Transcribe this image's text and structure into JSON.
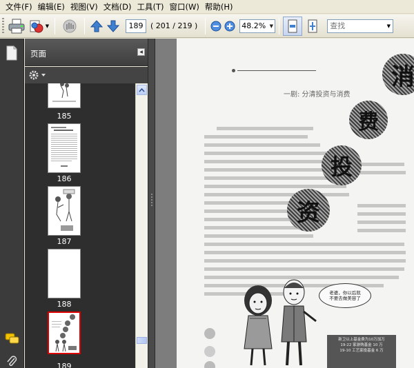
{
  "menu": [
    {
      "label": "文件(F)",
      "name": "menu-file"
    },
    {
      "label": "编辑(E)",
      "name": "menu-edit"
    },
    {
      "label": "视图(V)",
      "name": "menu-view"
    },
    {
      "label": "文档(D)",
      "name": "menu-document"
    },
    {
      "label": "工具(T)",
      "name": "menu-tools"
    },
    {
      "label": "窗口(W)",
      "name": "menu-window"
    },
    {
      "label": "帮助(H)",
      "name": "menu-help"
    }
  ],
  "toolbar": {
    "current_page": "189",
    "page_count": "( 201 / 219 )",
    "zoom": "48.2%",
    "search_placeholder": "查找"
  },
  "sidebar": {
    "title": "页面",
    "thumbnails": [
      {
        "label": "185"
      },
      {
        "label": "186"
      },
      {
        "label": "187"
      },
      {
        "label": "188"
      },
      {
        "label": "189",
        "selected": true
      }
    ]
  },
  "document": {
    "title_chars": [
      "消",
      "费",
      "投",
      "资"
    ],
    "sub_heading": "一剧: 分清投资与消费",
    "bubble_lines": [
      "老婆，你以后就",
      "不要去做美容了"
    ],
    "sign_lines": [
      "新卫以上基金费为10万加万",
      "19-22 家游购基金 10 万",
      "19-10 工艺家投基金 6 万"
    ]
  },
  "icons": {
    "print": "printer-icon",
    "export": "export-icon",
    "hand": "hand-tool-icon",
    "prev": "arrow-up-icon",
    "next": "arrow-down-icon",
    "zoom_out": "zoom-out-icon",
    "zoom_in": "zoom-in-icon"
  }
}
